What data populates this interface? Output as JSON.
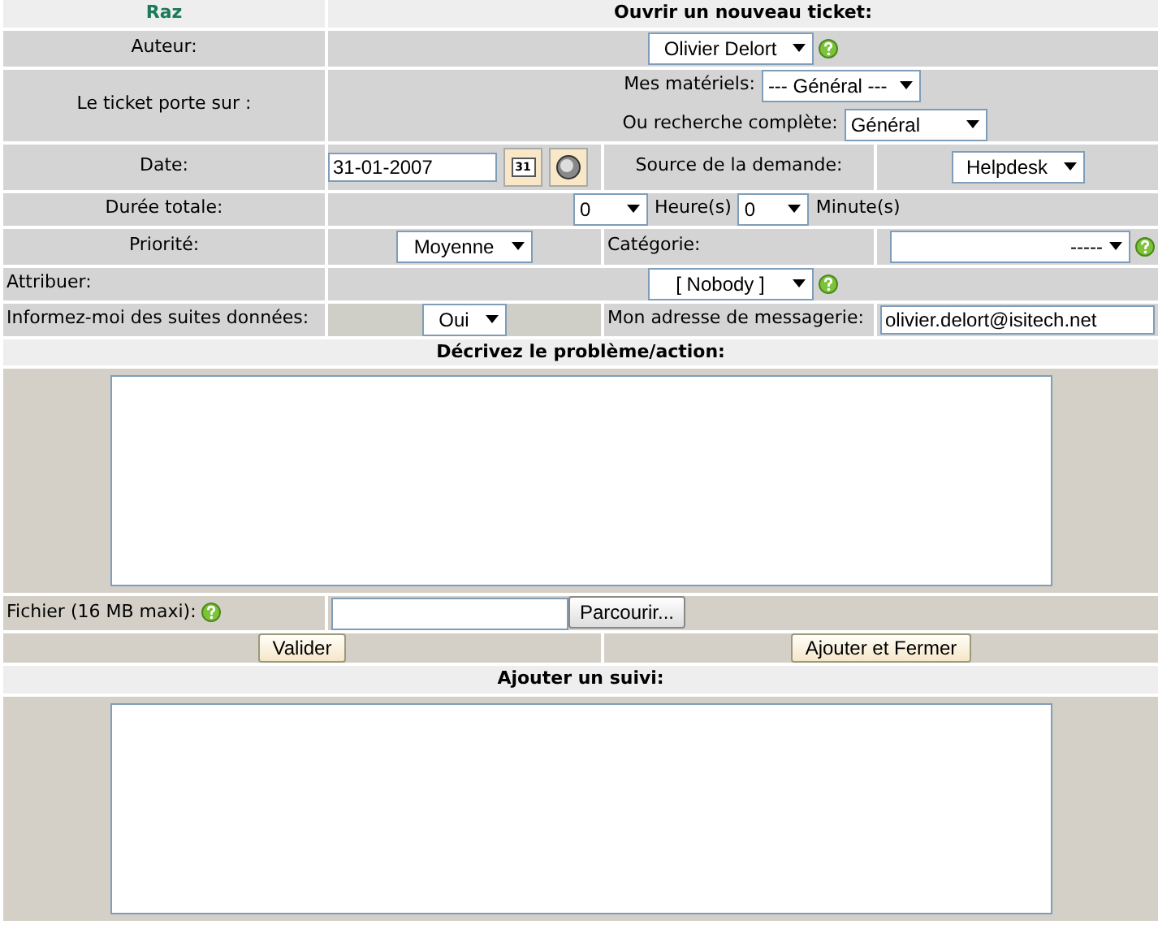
{
  "header": {
    "reset_link": "Raz",
    "title": "Ouvrir un nouveau ticket:"
  },
  "author": {
    "label": "Auteur:",
    "value": "Olivier Delort"
  },
  "subject": {
    "label": "Le ticket porte sur :",
    "my_items_label": "Mes matériels:",
    "my_items_value": "--- Général ---",
    "search_label": "Ou recherche complète:",
    "search_value": "Général"
  },
  "date": {
    "label": "Date:",
    "value": "31-01-2007",
    "calendar_icon_text": "31"
  },
  "source": {
    "label": "Source de la demande:",
    "value": "Helpdesk"
  },
  "duration": {
    "label": "Durée totale:",
    "hours_value": "0",
    "hours_label": "Heure(s)",
    "minutes_value": "0",
    "minutes_label": "Minute(s)"
  },
  "priority": {
    "label": "Priorité:",
    "value": "Moyenne"
  },
  "category": {
    "label": "Catégorie:",
    "value": "-----"
  },
  "assign": {
    "label": "Attribuer:",
    "value": "[ Nobody ]"
  },
  "notify": {
    "label": "Informez-moi des suites données:",
    "value": "Oui"
  },
  "email": {
    "label": "Mon adresse de messagerie:",
    "value": "olivier.delort@isitech.net"
  },
  "description": {
    "title": "Décrivez le problème/action:"
  },
  "file": {
    "label": "Fichier (16 MB maxi):",
    "browse_button": "Parcourir..."
  },
  "buttons": [
    "Valider",
    "Ajouter et Fermer"
  ],
  "followup": {
    "title": "Ajouter un suivi:"
  }
}
